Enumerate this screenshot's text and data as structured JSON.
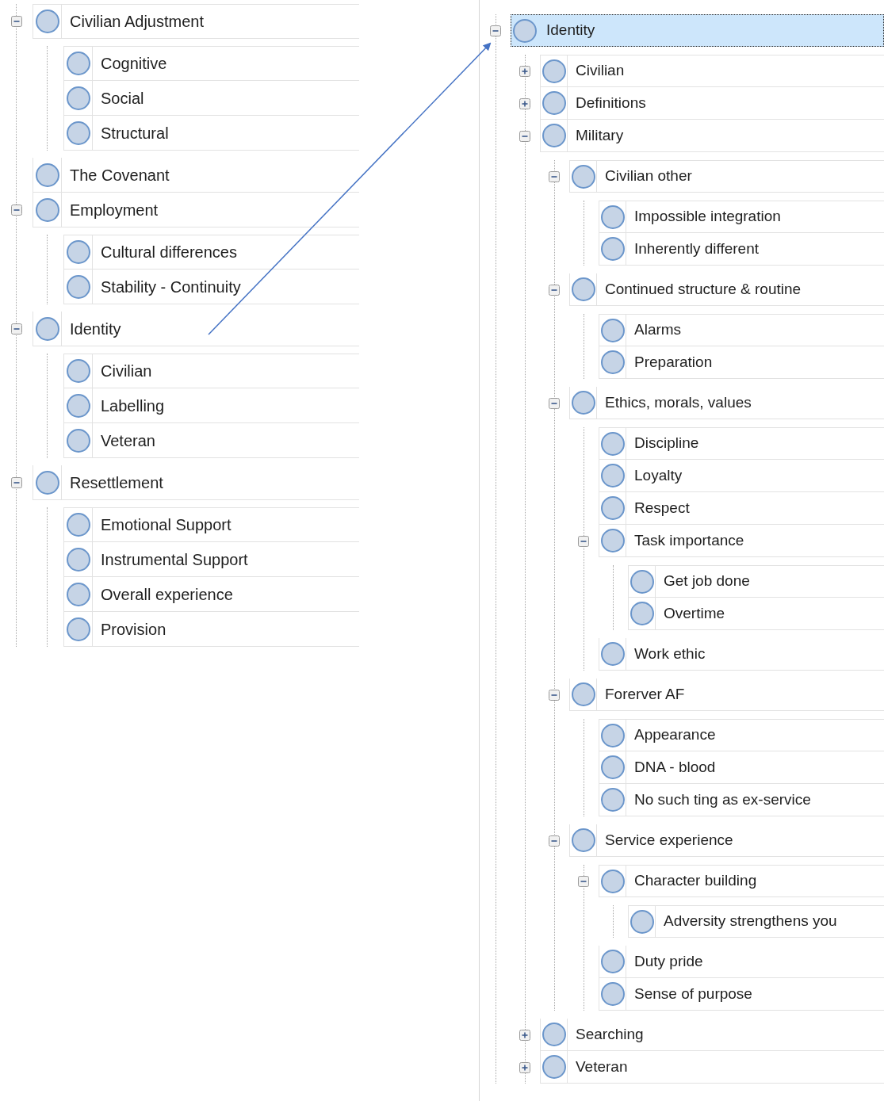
{
  "left_tree": [
    {
      "label": "Civilian Adjustment",
      "selected": false,
      "expanded": true,
      "children": [
        {
          "label": "Cognitive",
          "selected": false
        },
        {
          "label": "Social",
          "selected": false
        },
        {
          "label": "Structural",
          "selected": false
        }
      ]
    },
    {
      "label": "The Covenant",
      "selected": false
    },
    {
      "label": "Employment",
      "selected": false,
      "expanded": true,
      "children": [
        {
          "label": "Cultural differences",
          "selected": false
        },
        {
          "label": "Stability - Continuity",
          "selected": false
        }
      ]
    },
    {
      "label": "Identity",
      "selected": false,
      "expanded": true,
      "children": [
        {
          "label": "Civilian",
          "selected": false
        },
        {
          "label": "Labelling",
          "selected": false
        },
        {
          "label": "Veteran",
          "selected": false
        }
      ]
    },
    {
      "label": "Resettlement",
      "selected": false,
      "expanded": true,
      "children": [
        {
          "label": "Emotional Support",
          "selected": false
        },
        {
          "label": "Instrumental Support",
          "selected": false
        },
        {
          "label": "Overall experience",
          "selected": false
        },
        {
          "label": "Provision",
          "selected": false
        }
      ]
    }
  ],
  "right_tree": [
    {
      "label": "Identity",
      "selected": true,
      "expanded": true,
      "children": [
        {
          "label": "Civilian",
          "selected": false,
          "expanded": false
        },
        {
          "label": "Definitions",
          "selected": false,
          "expanded": false
        },
        {
          "label": "Military",
          "selected": false,
          "expanded": true,
          "children": [
            {
              "label": "Civilian other",
              "selected": false,
              "expanded": true,
              "children": [
                {
                  "label": "Impossible integration",
                  "selected": false
                },
                {
                  "label": "Inherently different",
                  "selected": false
                }
              ]
            },
            {
              "label": "Continued structure & routine",
              "selected": false,
              "expanded": true,
              "children": [
                {
                  "label": "Alarms",
                  "selected": false
                },
                {
                  "label": "Preparation",
                  "selected": false
                }
              ]
            },
            {
              "label": "Ethics, morals, values",
              "selected": false,
              "expanded": true,
              "children": [
                {
                  "label": "Discipline",
                  "selected": false
                },
                {
                  "label": "Loyalty",
                  "selected": false
                },
                {
                  "label": "Respect",
                  "selected": false
                },
                {
                  "label": "Task importance",
                  "selected": false,
                  "expanded": true,
                  "children": [
                    {
                      "label": "Get job done",
                      "selected": false
                    },
                    {
                      "label": "Overtime",
                      "selected": false
                    }
                  ]
                },
                {
                  "label": "Work ethic",
                  "selected": false
                }
              ]
            },
            {
              "label": "Forerver AF",
              "selected": false,
              "expanded": true,
              "children": [
                {
                  "label": "Appearance",
                  "selected": false
                },
                {
                  "label": "DNA - blood",
                  "selected": false
                },
                {
                  "label": "No such ting as ex-service",
                  "selected": false
                }
              ]
            },
            {
              "label": "Service experience",
              "selected": false,
              "expanded": true,
              "children": [
                {
                  "label": "Character building",
                  "selected": false,
                  "expanded": true,
                  "children": [
                    {
                      "label": "Adversity strengthens you",
                      "selected": false
                    }
                  ]
                },
                {
                  "label": "Duty pride",
                  "selected": false
                },
                {
                  "label": "Sense of purpose",
                  "selected": false
                }
              ]
            }
          ]
        },
        {
          "label": "Searching",
          "selected": false,
          "expanded": false
        },
        {
          "label": "Veteran",
          "selected": false,
          "expanded": false
        }
      ]
    }
  ]
}
